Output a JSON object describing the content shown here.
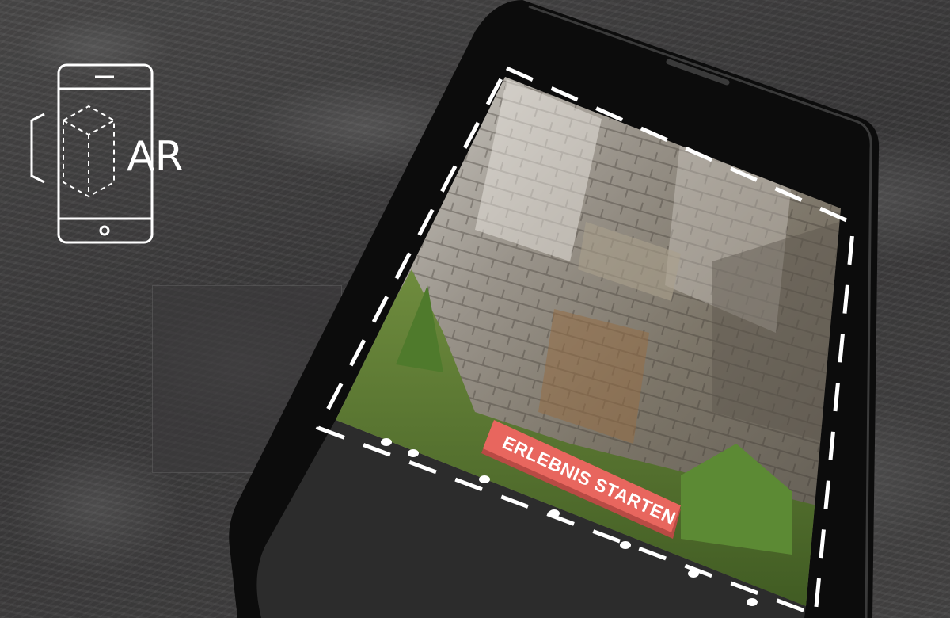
{
  "logo": {
    "label": "AR",
    "icon": "ar-phone-cube-icon",
    "color": "#ffffff"
  },
  "phone": {
    "body_color": "#0a0a0a",
    "bezel_color": "#2c2c2c",
    "frame_color": "#ffffff"
  },
  "start_button": {
    "label": "ERLEBNIS STARTEN",
    "color": "#e8665e"
  }
}
